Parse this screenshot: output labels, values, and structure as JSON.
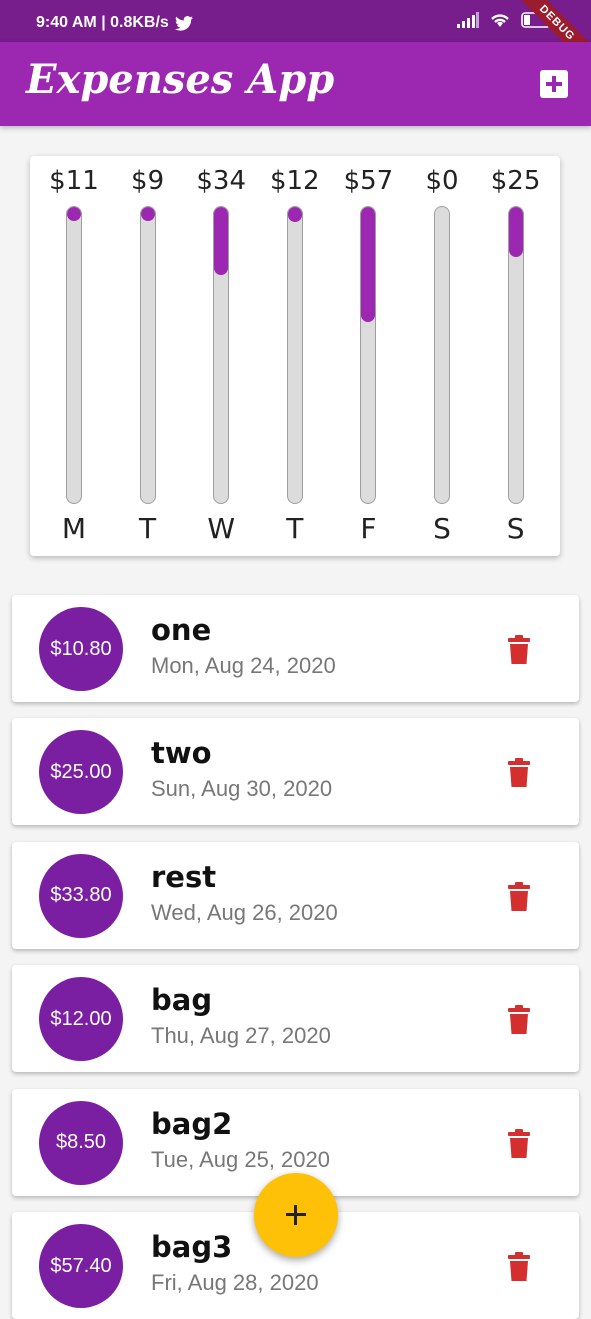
{
  "status_bar": {
    "time_speed": "9:40 AM | 0.8KB/s",
    "battery": "21",
    "debug_label": "DEBUG"
  },
  "app_bar": {
    "title": "Expenses App",
    "add_icon": "add-box-icon"
  },
  "chart": {
    "bars": [
      {
        "amount": "$11",
        "day": "M",
        "fraction": 0.04
      },
      {
        "amount": "$9",
        "day": "T",
        "fraction": 0.03
      },
      {
        "amount": "$34",
        "day": "W",
        "fraction": 0.23
      },
      {
        "amount": "$12",
        "day": "T",
        "fraction": 0.05
      },
      {
        "amount": "$57",
        "day": "F",
        "fraction": 0.39
      },
      {
        "amount": "$0",
        "day": "S",
        "fraction": 0.0
      },
      {
        "amount": "$25",
        "day": "S",
        "fraction": 0.17
      }
    ],
    "fill_color": "#9c27b0"
  },
  "transactions": [
    {
      "amount": "$10.80",
      "title": "one",
      "date": "Mon, Aug 24, 2020"
    },
    {
      "amount": "$25.00",
      "title": "two",
      "date": "Sun, Aug 30, 2020"
    },
    {
      "amount": "$33.80",
      "title": "rest",
      "date": "Wed, Aug 26, 2020"
    },
    {
      "amount": "$12.00",
      "title": "bag",
      "date": "Thu, Aug 27, 2020"
    },
    {
      "amount": "$8.50",
      "title": "bag2",
      "date": "Tue, Aug 25, 2020"
    },
    {
      "amount": "$57.40",
      "title": "bag3",
      "date": "Fri, Aug 28, 2020"
    }
  ],
  "colors": {
    "primary": "#9c27b0",
    "primary_dark": "#771d8c",
    "accent": "#ffc107",
    "delete": "#d32f2f"
  },
  "fab_icon": "add-icon"
}
